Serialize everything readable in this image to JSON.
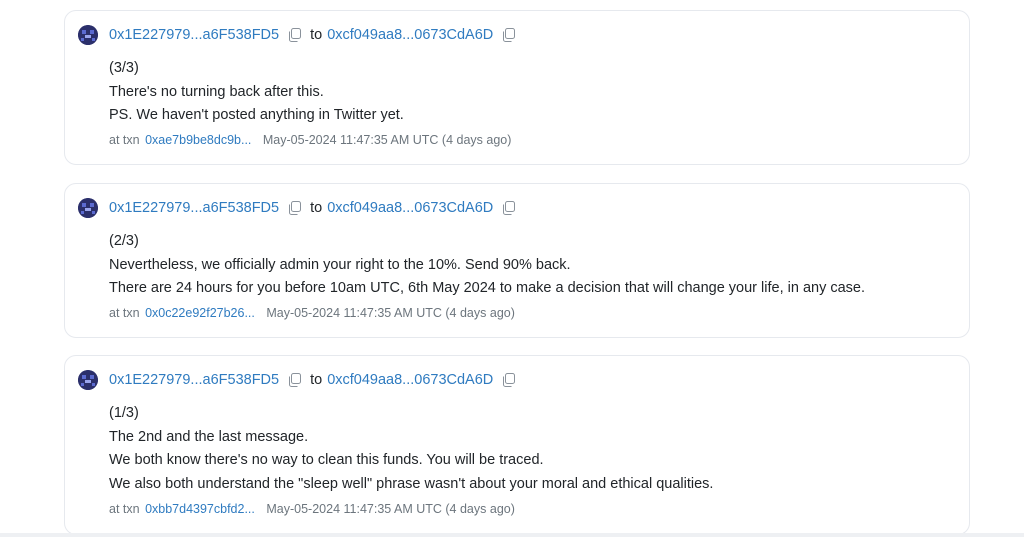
{
  "messages": [
    {
      "from_address": "0x1E227979...a6F538FD5",
      "to_word": "to",
      "to_address": "0xcf049aa8...0673CdA6D",
      "lines": [
        "(3/3)",
        "There's no turning back after this.",
        "PS. We haven't posted anything in Twitter yet."
      ],
      "at_txn_label": "at txn",
      "txn_hash": "0xae7b9be8dc9b...",
      "timestamp": "May-05-2024 11:47:35 AM UTC (4 days ago)"
    },
    {
      "from_address": "0x1E227979...a6F538FD5",
      "to_word": "to",
      "to_address": "0xcf049aa8...0673CdA6D",
      "lines": [
        "(2/3)",
        "Nevertheless, we officially admin your right to the 10%. Send 90% back.",
        "There are 24 hours for you before 10am UTC, 6th May 2024 to make a decision that will change your life, in any case."
      ],
      "at_txn_label": "at txn",
      "txn_hash": "0x0c22e92f27b26...",
      "timestamp": "May-05-2024 11:47:35 AM UTC (4 days ago)"
    },
    {
      "from_address": "0x1E227979...a6F538FD5",
      "to_word": "to",
      "to_address": "0xcf049aa8...0673CdA6D",
      "lines": [
        "(1/3)",
        "The 2nd and the last message.",
        "We both know there's no way to clean this funds. You will be traced.",
        "We also both understand the \"sleep well\" phrase wasn't about your moral and ethical qualities."
      ],
      "at_txn_label": "at txn",
      "txn_hash": "0xbb7d4397cbfd2...",
      "timestamp": "May-05-2024 11:47:35 AM UTC (4 days ago)"
    }
  ],
  "icons": {
    "avatar": "blockie-avatar-icon",
    "copy": "copy-icon"
  },
  "colors": {
    "link": "#2f7bc0",
    "text": "#212529",
    "muted": "#6c757d",
    "border": "#e6e9ee"
  }
}
